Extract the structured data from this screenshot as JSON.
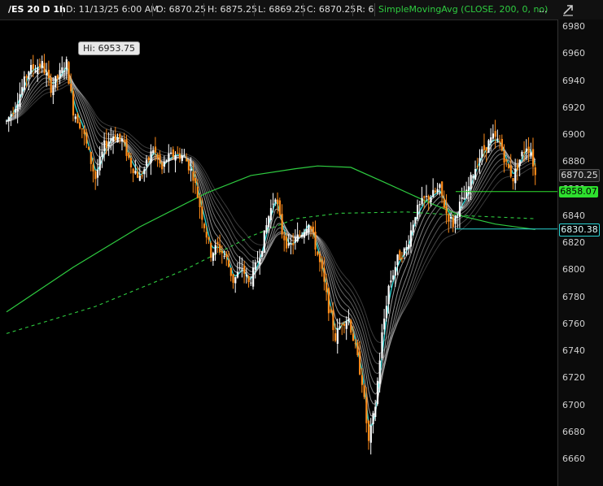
{
  "header": {
    "symbol": "/ES 20 D 1h",
    "date": "D: 11/13/25 6:00 AM",
    "open": "O: 6870.25",
    "high": "H: 6875.25",
    "low": "L: 6869.25",
    "close": "C: 6870.25",
    "range": "R: 6",
    "study": "SimpleMovingAvg (CLOSE, 200, 0, no)",
    "more": "..."
  },
  "hi_label": "Hi: 6953.75",
  "price_boxes": {
    "last": "6870.25",
    "green": "6858.07",
    "cyan": "6830.38"
  },
  "colors": {
    "up": "#ffffff",
    "down": "#ff8c1a",
    "ma_fast": "#2ad4d4",
    "ma_ribbon": "#bfbfbf",
    "sma200": "#2ecc40",
    "background": "#000000"
  },
  "chart_data": {
    "type": "candlestick",
    "symbol": "/ES",
    "timeframe": "20 D 1h",
    "ylim": [
      6650,
      6990
    ],
    "yticks": [
      6660,
      6680,
      6700,
      6720,
      6740,
      6760,
      6780,
      6800,
      6820,
      6840,
      6860,
      6880,
      6900,
      6920,
      6940,
      6960,
      6980
    ],
    "price_path": [
      [
        0,
        6910
      ],
      [
        4,
        6922
      ],
      [
        10,
        6948
      ],
      [
        16,
        6952
      ],
      [
        20,
        6935
      ],
      [
        24,
        6945
      ],
      [
        27,
        6953
      ],
      [
        30,
        6918
      ],
      [
        34,
        6905
      ],
      [
        38,
        6880
      ],
      [
        40,
        6868
      ],
      [
        44,
        6892
      ],
      [
        48,
        6900
      ],
      [
        52,
        6896
      ],
      [
        56,
        6878
      ],
      [
        60,
        6868
      ],
      [
        63,
        6878
      ],
      [
        66,
        6890
      ],
      [
        70,
        6874
      ],
      [
        72,
        6882
      ],
      [
        76,
        6886
      ],
      [
        80,
        6884
      ],
      [
        84,
        6870
      ],
      [
        88,
        6840
      ],
      [
        92,
        6812
      ],
      [
        95,
        6818
      ],
      [
        99,
        6808
      ],
      [
        102,
        6792
      ],
      [
        106,
        6802
      ],
      [
        109,
        6790
      ],
      [
        112,
        6802
      ],
      [
        115,
        6818
      ],
      [
        118,
        6840
      ],
      [
        121,
        6856
      ],
      [
        124,
        6828
      ],
      [
        127,
        6816
      ],
      [
        130,
        6822
      ],
      [
        133,
        6828
      ],
      [
        136,
        6836
      ],
      [
        139,
        6818
      ],
      [
        142,
        6798
      ],
      [
        145,
        6772
      ],
      [
        148,
        6750
      ],
      [
        151,
        6762
      ],
      [
        154,
        6764
      ],
      [
        157,
        6742
      ],
      [
        160,
        6718
      ],
      [
        163,
        6672
      ],
      [
        166,
        6700
      ],
      [
        169,
        6752
      ],
      [
        172,
        6788
      ],
      [
        176,
        6808
      ],
      [
        180,
        6816
      ],
      [
        184,
        6842
      ],
      [
        188,
        6852
      ],
      [
        192,
        6856
      ],
      [
        195,
        6860
      ],
      [
        198,
        6842
      ],
      [
        201,
        6834
      ],
      [
        204,
        6848
      ],
      [
        207,
        6856
      ],
      [
        210,
        6872
      ],
      [
        213,
        6884
      ],
      [
        216,
        6892
      ],
      [
        219,
        6898
      ],
      [
        222,
        6894
      ],
      [
        225,
        6878
      ],
      [
        228,
        6868
      ],
      [
        231,
        6882
      ],
      [
        234,
        6892
      ],
      [
        236,
        6888
      ],
      [
        238,
        6870
      ]
    ],
    "sma200": [
      [
        0,
        6769
      ],
      [
        30,
        6802
      ],
      [
        60,
        6832
      ],
      [
        90,
        6857
      ],
      [
        110,
        6870
      ],
      [
        130,
        6875
      ],
      [
        140,
        6877
      ],
      [
        155,
        6876
      ],
      [
        170,
        6865
      ],
      [
        190,
        6850
      ],
      [
        205,
        6840
      ],
      [
        220,
        6834
      ],
      [
        238,
        6830
      ]
    ],
    "sma200_dashed": [
      [
        0,
        6753
      ],
      [
        40,
        6773
      ],
      [
        80,
        6800
      ],
      [
        110,
        6825
      ],
      [
        130,
        6838
      ],
      [
        150,
        6842
      ],
      [
        180,
        6843
      ],
      [
        210,
        6840
      ],
      [
        238,
        6838
      ]
    ],
    "annotations": [
      {
        "label": "Hi: 6953.75",
        "x": 27,
        "y": 6953.75
      }
    ],
    "horizontal_levels": [
      6858.07,
      6830.38
    ],
    "last_price": 6870.25
  }
}
